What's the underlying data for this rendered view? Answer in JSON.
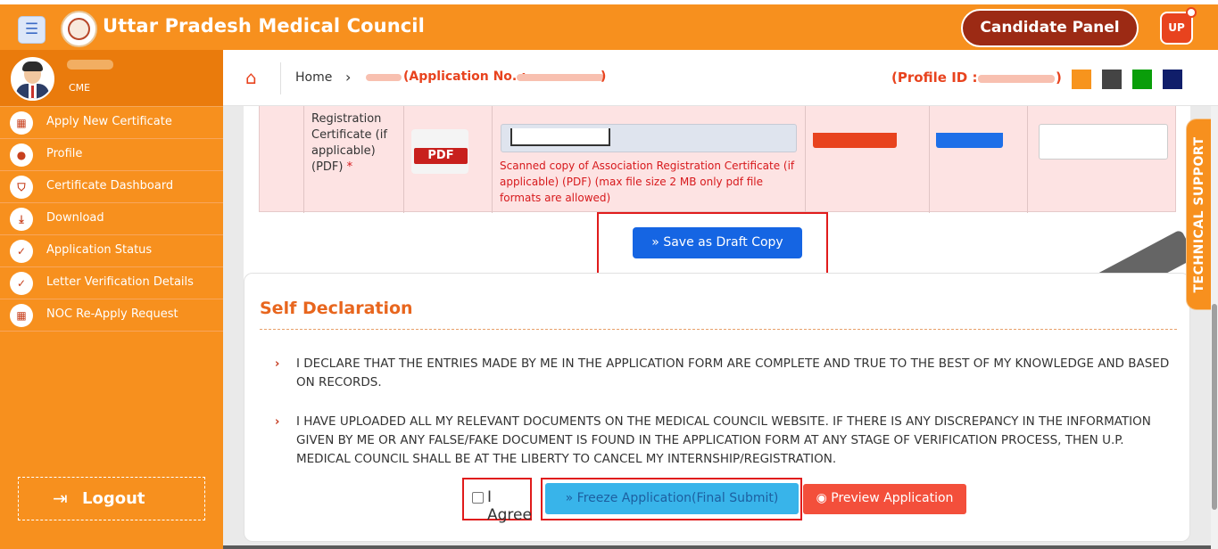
{
  "header": {
    "menu_icon": "hamburger-icon",
    "title": "Uttar Pradesh Medical Council",
    "candidate_panel": "Candidate Panel",
    "up_badge": "UP",
    "colors": {
      "orange": "#f7901e",
      "dark_red": "#9c2a14"
    }
  },
  "sidebar": {
    "user_role": "CME",
    "items": [
      {
        "label": "Apply New Certificate",
        "icon": "grid-icon"
      },
      {
        "label": "Profile",
        "icon": "user-icon"
      },
      {
        "label": "Certificate Dashboard",
        "icon": "shield-icon"
      },
      {
        "label": "Download",
        "icon": "download-icon"
      },
      {
        "label": "Application Status",
        "icon": "check-circle-icon"
      },
      {
        "label": "Letter Verification Details",
        "icon": "check-circle-icon"
      },
      {
        "label": "NOC Re-Apply Request",
        "icon": "grid-icon"
      }
    ],
    "logout": "Logout"
  },
  "breadcrumb": {
    "home": "Home",
    "separator": "›",
    "application_prefix": "(Application No. :",
    "application_suffix": ")",
    "profile_prefix": "(Profile ID :",
    "profile_suffix": ")",
    "theme_colors": [
      "#f7941d",
      "#444444",
      "#0a9e0a",
      "#101e6a"
    ]
  },
  "upload_row": {
    "doc_label": "Registration Certificate (if applicable) (PDF)",
    "required_mark": "*",
    "pdf_badge": "PDF",
    "help_text": "Scanned copy of Association Registration Certificate (if applicable) (PDF) (max file size 2 MB only pdf file formats are allowed)"
  },
  "draft_button": "» Save as Draft Copy",
  "declaration": {
    "title": "Self Declaration",
    "items": [
      "I DECLARE THAT THE ENTRIES MADE BY ME IN THE APPLICATION FORM ARE COMPLETE AND TRUE TO THE BEST OF MY KNOWLEDGE AND BASED ON RECORDS.",
      "I HAVE UPLOADED ALL MY RELEVANT DOCUMENTS ON THE MEDICAL COUNCIL WEBSITE. IF THERE IS ANY DISCREPANCY IN THE INFORMATION GIVEN BY ME OR ANY FALSE/FAKE DOCUMENT IS FOUND IN THE APPLICATION FORM AT ANY STAGE OF VERIFICATION PROCESS, THEN U.P. MEDICAL COUNCIL SHALL BE AT THE LIBERTY TO CANCEL MY INTERNSHIP/REGISTRATION."
    ],
    "agree_label": "I Agree",
    "freeze_button": "» Freeze Application(Final Submit)",
    "preview_button": "Preview Application"
  },
  "technical_support": "TECHNICAL SUPPORT"
}
